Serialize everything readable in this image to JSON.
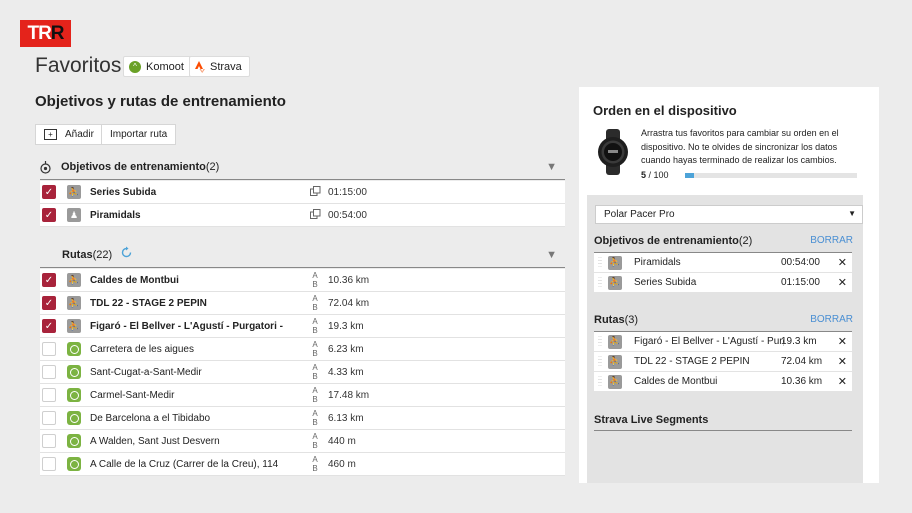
{
  "logo": {
    "letters": [
      "T",
      "R",
      "R"
    ]
  },
  "header": {
    "title": "Favoritos",
    "chips": [
      {
        "label": "Komoot",
        "icon": "komoot-icon"
      },
      {
        "label": "Strava",
        "icon": "strava-icon"
      }
    ]
  },
  "main": {
    "title": "Objetivos y rutas de entrenamiento",
    "actions": {
      "add_label": "Añadir",
      "import_label": "Importar ruta"
    },
    "goals": {
      "label": "Objetivos de entrenamiento",
      "count": "(2)",
      "items": [
        {
          "name": "Series Subida",
          "value": "01:15:00",
          "checked": true
        },
        {
          "name": "Piramidals",
          "value": "00:54:00",
          "checked": true
        }
      ]
    },
    "routes": {
      "label": "Rutas",
      "count": "(22)",
      "ab_label": "A B",
      "items": [
        {
          "name": "Caldes de Montbui",
          "value": "10.36 km",
          "checked": true,
          "source": "polar"
        },
        {
          "name": "TDL 22 - STAGE 2 PEPIN",
          "value": "72.04 km",
          "checked": true,
          "source": "polar"
        },
        {
          "name": "Figaró - El Bellver - L'Agustí - Purgatori -",
          "value": "19.3 km",
          "checked": true,
          "source": "polar"
        },
        {
          "name": "Carretera de les aigues",
          "value": "6.23 km",
          "checked": false,
          "source": "komoot"
        },
        {
          "name": "Sant-Cugat-a-Sant-Medir",
          "value": "4.33 km",
          "checked": false,
          "source": "komoot"
        },
        {
          "name": "Carmel-Sant-Medir",
          "value": "17.48 km",
          "checked": false,
          "source": "komoot"
        },
        {
          "name": "De Barcelona a el Tibidabo",
          "value": "6.13 km",
          "checked": false,
          "source": "komoot"
        },
        {
          "name": "A Walden, Sant Just Desvern",
          "value": "440 m",
          "checked": false,
          "source": "komoot"
        },
        {
          "name": "A Calle de la Cruz (Carrer de la Creu), 114",
          "value": "460 m",
          "checked": false,
          "source": "komoot"
        }
      ]
    }
  },
  "device": {
    "title": "Orden en el dispositivo",
    "description": "Arrastra tus favoritos para cambiar su orden en el dispositivo. No te olvides de sincronizar los datos cuando hayas terminado de realizar los cambios.",
    "count_current": "5",
    "count_total": "/ 100",
    "progress": 0.05,
    "device_name": "Polar Pacer Pro",
    "goals": {
      "label": "Objetivos de entrenamiento",
      "count": "(2)",
      "clear_label": "BORRAR",
      "items": [
        {
          "name": "Piramidals",
          "value": "00:54:00"
        },
        {
          "name": "Series Subida",
          "value": "01:15:00"
        }
      ]
    },
    "routes": {
      "label": "Rutas",
      "count": "(3)",
      "clear_label": "BORRAR",
      "items": [
        {
          "name": "Figaró - El Bellver - L'Agustí - Purgatori",
          "value": "19.3 km"
        },
        {
          "name": "TDL 22 - STAGE 2 PEPIN",
          "value": "72.04 km"
        },
        {
          "name": "Caldes de Montbui",
          "value": "10.36 km"
        }
      ]
    },
    "strava_live": "Strava Live Segments"
  },
  "colors": {
    "brand_red": "#e4231b",
    "checkbox": "#a8233b",
    "komoot_green": "#7cb342",
    "link_blue": "#4a8fd3"
  }
}
